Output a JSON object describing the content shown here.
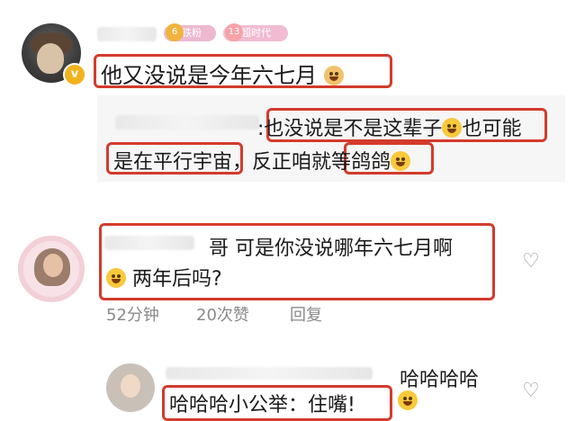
{
  "comment1": {
    "badge_fan": "铁粉",
    "badge_fan_level": "6",
    "badge_time": "超时代",
    "badge_time_level": "13",
    "text": "他又没说是今年六七月"
  },
  "quote": {
    "part1": "也没说是不是这辈子",
    "part2": "也可能",
    "part3": "是在平行宇宙",
    "part4": "，反正咱就",
    "part5": "等鸽鸽"
  },
  "comment2": {
    "line1": "哥 可是你没说哪年六七月啊",
    "line2": "两年后吗?",
    "time": "52分钟",
    "likes": "20次赞",
    "reply": "回复"
  },
  "comment3": {
    "top_text": "哈哈哈哈",
    "text": "哈哈哈小公举：住嘴!"
  },
  "colors": {
    "highlight_border": "#d33b2c",
    "badge_fan": "#ecb9cf",
    "badge_time": "#f1bcd2"
  }
}
